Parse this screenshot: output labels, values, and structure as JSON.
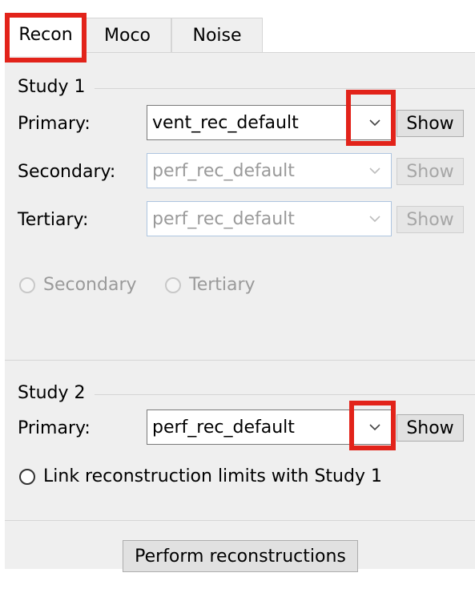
{
  "tabs": [
    {
      "label": "Recon",
      "active": true
    },
    {
      "label": "Moco",
      "active": false
    },
    {
      "label": "Noise",
      "active": false
    }
  ],
  "study1": {
    "title": "Study 1",
    "primary": {
      "label": "Primary:",
      "value": "vent_rec_default",
      "show_label": "Show"
    },
    "secondary": {
      "label": "Secondary:",
      "value": "perf_rec_default",
      "show_label": "Show"
    },
    "tertiary": {
      "label": "Tertiary:",
      "value": "perf_rec_default",
      "show_label": "Show"
    },
    "radio_secondary": "Secondary",
    "radio_tertiary": "Tertiary"
  },
  "study2": {
    "title": "Study 2",
    "primary": {
      "label": "Primary:",
      "value": "perf_rec_default",
      "show_label": "Show"
    },
    "link_label": "Link reconstruction limits with Study 1"
  },
  "perform_button": "Perform reconstructions",
  "colors": {
    "highlight": "#e2231a",
    "panel_bg": "#efefef",
    "disabled_text": "#9a9a9a"
  }
}
